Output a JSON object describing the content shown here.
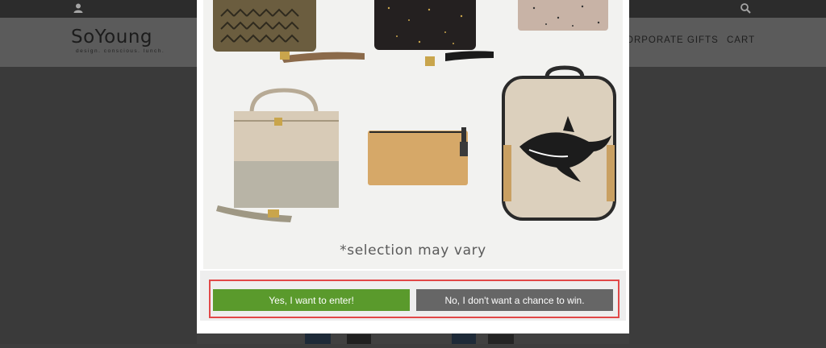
{
  "topbar": {
    "user_icon": "user-icon",
    "search_icon": "search-icon"
  },
  "header": {
    "logo_name": "SoYoung",
    "logo_tagline": "design. conscious. lunch.",
    "nav": [
      "ORPORATE GIFTS",
      "CART"
    ]
  },
  "modal": {
    "photo_caption": "*selection may vary",
    "yes_label": "Yes, I want to enter!",
    "no_label": "No, I don't want a chance to win."
  },
  "colors": {
    "yes_button": "#5a9a2c",
    "no_button": "#666666",
    "highlight": "#e14848"
  }
}
